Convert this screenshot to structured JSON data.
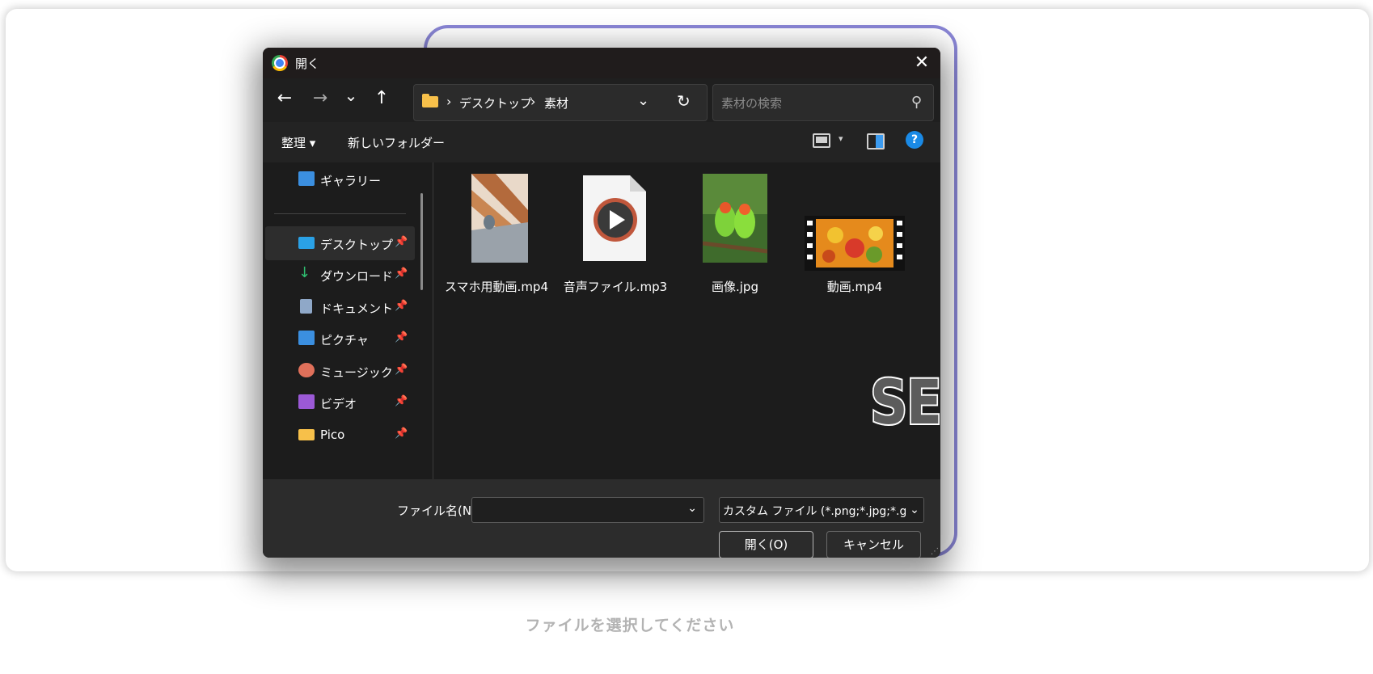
{
  "dialog": {
    "title": "開く",
    "close_glyph": "✕",
    "nav": {
      "back_glyph": "←",
      "forward_glyph": "→",
      "recent_glyph": "⌄",
      "up_glyph": "↑"
    },
    "address": {
      "crumbs": [
        "デスクトップ",
        "素材"
      ],
      "separator": "›",
      "chevron_glyph": "⌄",
      "refresh_glyph": "↻"
    },
    "search": {
      "placeholder": "素材の検索",
      "icon_glyph": "⚲"
    },
    "command_bar": {
      "organize_label": "整理 ▾",
      "new_folder_label": "新しいフォルダー",
      "view_chevron": "▾",
      "help_glyph": "?"
    },
    "sidebar": {
      "gallery": {
        "label": "ギャラリー",
        "icon": "gallery-icon",
        "color": "#3b8fe0"
      },
      "items": [
        {
          "label": "デスクトップ",
          "icon": "desktop-icon",
          "color": "#2aa1e6",
          "pinned": true,
          "selected": true
        },
        {
          "label": "ダウンロード",
          "icon": "download-icon",
          "color": "#2fbf71",
          "pinned": true,
          "selected": false
        },
        {
          "label": "ドキュメント",
          "icon": "document-icon",
          "color": "#8fa8c8",
          "pinned": true,
          "selected": false
        },
        {
          "label": "ピクチャ",
          "icon": "pictures-icon",
          "color": "#3b8fe0",
          "pinned": true,
          "selected": false
        },
        {
          "label": "ミュージック",
          "icon": "music-icon",
          "color": "#e0705a",
          "pinned": true,
          "selected": false
        },
        {
          "label": "ビデオ",
          "icon": "videos-icon",
          "color": "#9b59d6",
          "pinned": true,
          "selected": false
        },
        {
          "label": "Pico",
          "icon": "folder-icon",
          "color": "#f7c04a",
          "pinned": true,
          "selected": false
        }
      ],
      "pin_glyph": "📌"
    },
    "files": [
      {
        "name": "スマホ用動画.mp4",
        "icon": "video-thumbnail-icon"
      },
      {
        "name": "音声ファイル.mp3",
        "icon": "audio-file-icon"
      },
      {
        "name": "画像.jpg",
        "icon": "image-thumbnail-icon"
      },
      {
        "name": "動画.mp4",
        "icon": "film-thumbnail-icon"
      }
    ],
    "footer": {
      "filename_label": "ファイル名(N):",
      "filename_value": "",
      "filetype_value": "カスタム ファイル (*.png;*.jpg;*.gif;",
      "open_label": "開く(O)",
      "cancel_label": "キャンセル",
      "chevron_glyph": "⌄"
    }
  },
  "overlay_text": "SELECT",
  "caption": "ファイルを選択してください",
  "colors": {
    "focus_ring": "#8a86d6",
    "dialog_bg": "#1c1c1c",
    "accent": "#1a8ae6"
  }
}
